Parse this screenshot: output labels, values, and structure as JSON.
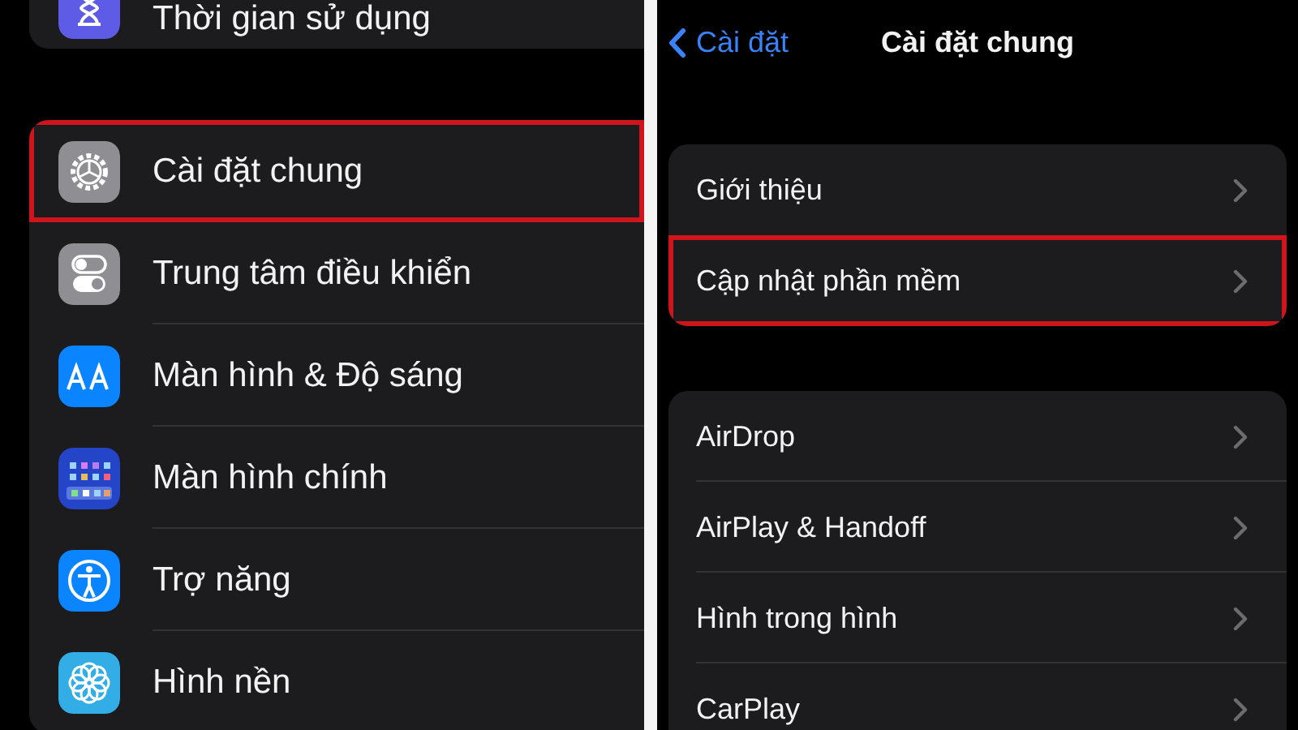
{
  "left_panel": {
    "items": [
      {
        "label": "Thời gian sử dụng",
        "highlighted": false
      },
      {
        "label": "Cài đặt chung",
        "highlighted": true
      },
      {
        "label": "Trung tâm điều khiển",
        "highlighted": false
      },
      {
        "label": "Màn hình & Độ sáng",
        "highlighted": false
      },
      {
        "label": "Màn hình chính",
        "highlighted": false
      },
      {
        "label": "Trợ năng",
        "highlighted": false
      },
      {
        "label": "Hình nền",
        "highlighted": false
      }
    ]
  },
  "right_panel": {
    "back_label": "Cài đặt",
    "title": "Cài đặt chung",
    "groups": [
      [
        {
          "label": "Giới thiệu",
          "highlighted": false
        },
        {
          "label": "Cập nhật phần mềm",
          "highlighted": true
        }
      ],
      [
        {
          "label": "AirDrop",
          "highlighted": false
        },
        {
          "label": "AirPlay & Handoff",
          "highlighted": false
        },
        {
          "label": "Hình trong hình",
          "highlighted": false
        },
        {
          "label": "CarPlay",
          "highlighted": false
        }
      ]
    ]
  }
}
